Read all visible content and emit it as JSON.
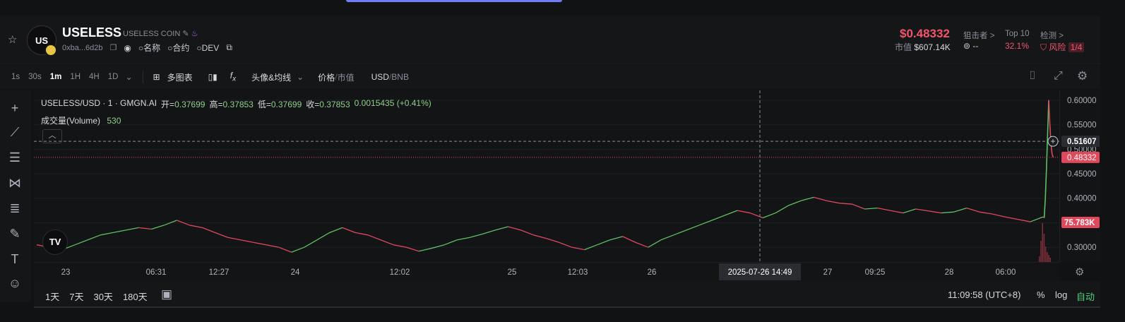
{
  "token": {
    "symbol": "USELESS",
    "name": "USELESS COIN",
    "avatar_text": "US",
    "address": "0xba...6d2b",
    "links": [
      "名称",
      "合约",
      "DEV"
    ]
  },
  "price": {
    "current": "$0.48332",
    "mcap_label": "市值",
    "mcap_value": "$607.14K"
  },
  "stats": [
    {
      "label": "狙击者 >",
      "value": "--",
      "color": "#c9cdd4"
    },
    {
      "label": "Top 10",
      "value": "32.1%",
      "color": "#f2556b"
    },
    {
      "label": "检测 >",
      "value": "风险",
      "extra": "1/4",
      "color": "#f2556b"
    }
  ],
  "timeframes": [
    "1s",
    "30s",
    "1m",
    "1H",
    "4H",
    "1D"
  ],
  "active_timeframe": "1m",
  "toolbar": {
    "multi_chart": "多图表",
    "indicator": "头像&均线",
    "price_label": "价格",
    "mcap_label": "市值",
    "usd": "USD",
    "bnb": "BNB"
  },
  "legend": {
    "title": "USELESS/USD · 1 · GMGN.AI",
    "open_label": "开=",
    "open": "0.37699",
    "high_label": "高=",
    "high": "0.37853",
    "low_label": "低=",
    "low": "0.37699",
    "close_label": "收=",
    "close": "0.37853",
    "change": "0.0015435 (+0.41%)",
    "volume_label": "成交量(Volume)",
    "volume": "530"
  },
  "ranges": [
    "1天",
    "7天",
    "30天",
    "180天"
  ],
  "clock": "11:09:58 (UTC+8)",
  "scale_options": {
    "percent": "%",
    "log": "log",
    "auto": "自动"
  },
  "crosshair": {
    "time_label": "2025-07-26   14:49",
    "price_label": "0.51607"
  },
  "price_line_label": "0.48332",
  "volume_tag": "75.783K",
  "chart_data": {
    "type": "line",
    "ylim": [
      0.27,
      0.62
    ],
    "y_ticks": [
      "0.60000",
      "0.55000",
      "0.50000",
      "0.45000",
      "0.40000",
      "0.35000",
      "0.30000"
    ],
    "x_ticks": [
      "23",
      "06:31",
      "12:27",
      "24",
      "12:02",
      "25",
      "12:03",
      "26",
      "27",
      "09:25",
      "28",
      "06:00"
    ],
    "series": [
      {
        "x": [
          0,
          1,
          2,
          3,
          4,
          5,
          6,
          7,
          8,
          9,
          10,
          11,
          12,
          13,
          14,
          15,
          16,
          17,
          18,
          19,
          20,
          21,
          22,
          23,
          24,
          25,
          26,
          27,
          28,
          29,
          30,
          31,
          32,
          33,
          34,
          35,
          36,
          37,
          38,
          39,
          40,
          41,
          42,
          43,
          44,
          45,
          46,
          47,
          48,
          49,
          50,
          51,
          52,
          53,
          54,
          55,
          56,
          57,
          58,
          59,
          60,
          61,
          62,
          63,
          64,
          65,
          66,
          67,
          68,
          69,
          70,
          71,
          72,
          73,
          74,
          75,
          76,
          77,
          78,
          79
        ],
        "y": [
          0.305,
          0.3,
          0.295,
          0.305,
          0.315,
          0.325,
          0.33,
          0.335,
          0.34,
          0.337,
          0.345,
          0.355,
          0.345,
          0.34,
          0.33,
          0.32,
          0.315,
          0.31,
          0.305,
          0.3,
          0.29,
          0.3,
          0.315,
          0.33,
          0.34,
          0.33,
          0.325,
          0.315,
          0.305,
          0.3,
          0.292,
          0.298,
          0.305,
          0.315,
          0.32,
          0.327,
          0.335,
          0.342,
          0.335,
          0.325,
          0.318,
          0.31,
          0.3,
          0.295,
          0.305,
          0.315,
          0.322,
          0.31,
          0.3,
          0.315,
          0.325,
          0.335,
          0.345,
          0.355,
          0.365,
          0.375,
          0.37,
          0.36,
          0.37,
          0.385,
          0.395,
          0.402,
          0.395,
          0.39,
          0.388,
          0.378,
          0.38,
          0.375,
          0.37,
          0.378,
          0.374,
          0.37,
          0.372,
          0.38,
          0.372,
          0.368,
          0.362,
          0.357,
          0.352,
          0.362
        ]
      }
    ],
    "spike": [
      0.36,
      0.4,
      0.46,
      0.53,
      0.6,
      0.55,
      0.51,
      0.49,
      0.48332
    ]
  }
}
